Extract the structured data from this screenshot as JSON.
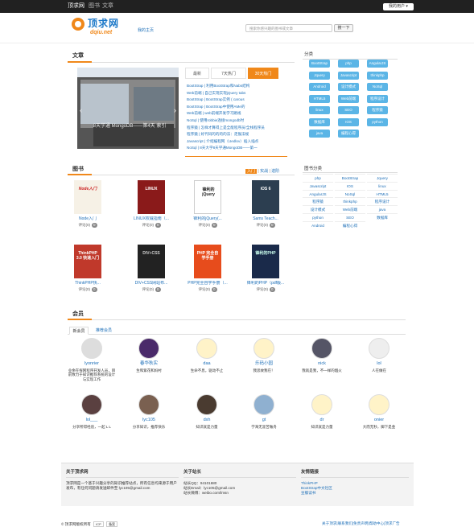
{
  "topbar": {
    "brand": "顶求网",
    "nav": [
      "图书",
      "文章"
    ],
    "user_menu": "我的用户 ▾"
  },
  "header": {
    "logo_name": "顶求网",
    "logo_sub": "dqiu.net",
    "home_link": "我的主页",
    "search_placeholder": "搜索你感兴趣的图书或文章",
    "search_button": "搜一下"
  },
  "articles": {
    "title": "文章",
    "carousel_caption": "8天学通 MongoDB——第4天 索引",
    "tabs": [
      "最新",
      "7天热门",
      "30天热门"
    ],
    "active_tab": 2,
    "items": [
      "BootStrap | 利用BootStrap和Nabs结构",
      "Web前端 | 自己实现实现jQuery tabs",
      "BootStrap | BootStrap实例 ( carous",
      "BootStrap | BootStrap中使用AMe的",
      "Web前端 | web前端开发学习路线",
      "NoSql | 使用robbie连接mongodb时",
      "程序猿 | 怎样才算得上是全能程序员/全栈程序员",
      "程序猿 | 好代码的的的的法：走猴法规",
      "Javascript | 介绍编程网（Uedlov）插入插点",
      "NoSql | 8天大学8天学通MongoDB——第一"
    ]
  },
  "categories": {
    "title": "分类",
    "items": [
      "BootStrap",
      "php",
      "AngularJS",
      "Jquery",
      "Javascript",
      "thinkphp",
      "Android",
      "设计模式",
      "NoSql",
      "HTML5",
      "Web前端",
      "程序设计",
      "linux",
      "SEO",
      "程序猿",
      "数据库",
      "IOS",
      "python",
      "java",
      "编程心得"
    ]
  },
  "books": {
    "title": "图书",
    "filters": [
      "入门",
      "实战",
      "进阶"
    ],
    "review_label": "评论(0)",
    "review_badge": "0",
    "items": [
      {
        "title": "Node入门"
      },
      {
        "title": "LINUX权威指南（..."
      },
      {
        "title": "锋利的jQuery(..."
      },
      {
        "title": "Sams Teach..."
      },
      {
        "title": "ThinkPHP快..."
      },
      {
        "title": "DIV+CSS网站布..."
      },
      {
        "title": "PHP完全自学手册（..."
      },
      {
        "title": "锋利的PHP（pdf版..."
      }
    ],
    "cover_texts": [
      "Node入门",
      "LINUX",
      "锋利的jQuery",
      "iOS 6",
      "ThinkPHP 3.0 快速入门",
      "DIV+CSS",
      "PHP 完全自学手册",
      "锋利的PHP"
    ],
    "tags_title": "图书分类",
    "tags": [
      "php",
      "BootStrap",
      "Jquery",
      "Javascript",
      "IOS",
      "linux",
      "AngularJS",
      "NoSql",
      "HTML5",
      "程序猿",
      "thinkphp",
      "程序设计",
      "设计模式",
      "Web前端",
      "java",
      "python",
      "SEO",
      "数据库",
      "Android",
      "编程心得"
    ]
  },
  "members": {
    "title": "会员",
    "tabs": [
      "新会员",
      "推荐会员"
    ],
    "items": [
      {
        "name": "lyonrier",
        "desc": "业余在探网程序开发人员，目前致力于知识推荐系统的设计与实现工作"
      },
      {
        "name": "春华秋实",
        "desc": "生和紫花和妈村"
      },
      {
        "name": "daa",
        "desc": "生命不息，驱动不止"
      },
      {
        "name": "乐码小园",
        "desc": "我思故我在！"
      },
      {
        "name": "nick",
        "desc": "我就是我，不一样的烟火"
      },
      {
        "name": "lol",
        "desc": "人在做在"
      },
      {
        "name": "lol___",
        "desc": "分享所得经验，一起 L L"
      },
      {
        "name": "lyc105",
        "desc": "分享知识，推荐快乐"
      },
      {
        "name": "dxh",
        "desc": "知识就是力量"
      },
      {
        "name": "gt",
        "desc": "学海无涯苦做舟"
      },
      {
        "name": "dr",
        "desc": "知识就是力量"
      },
      {
        "name": "onier",
        "desc": "大而无秒，脚下是金"
      }
    ]
  },
  "footer": {
    "about_title": "关于顶求网",
    "about_text": "顶求网是一个基于兴趣分享的知识推荐站点，所有信息均来源于用户发布，有任何问题请发送邮件至 lyc105@gmail.com",
    "site_title": "关于站长",
    "site_lines": [
      "站长QQ：94101680",
      "站长Email：lyc105@gmail.com",
      "站长微博：weibo.com/lmsn"
    ],
    "links_title": "友情链接",
    "links": [
      "ThinkPHP",
      "BootStrap中文社区",
      "豆瓣读书"
    ],
    "copyright": "© 顶求网版权所有",
    "badges": [
      "ICP",
      "备案"
    ],
    "bottom_links": "关于顶求|联系我们|免责声明|帮助中心|顶求广告"
  },
  "colors": {
    "accent": "#f0881a",
    "link": "#1d6fb8",
    "category_button": "#5bb5e6",
    "topbar": "#212121"
  }
}
